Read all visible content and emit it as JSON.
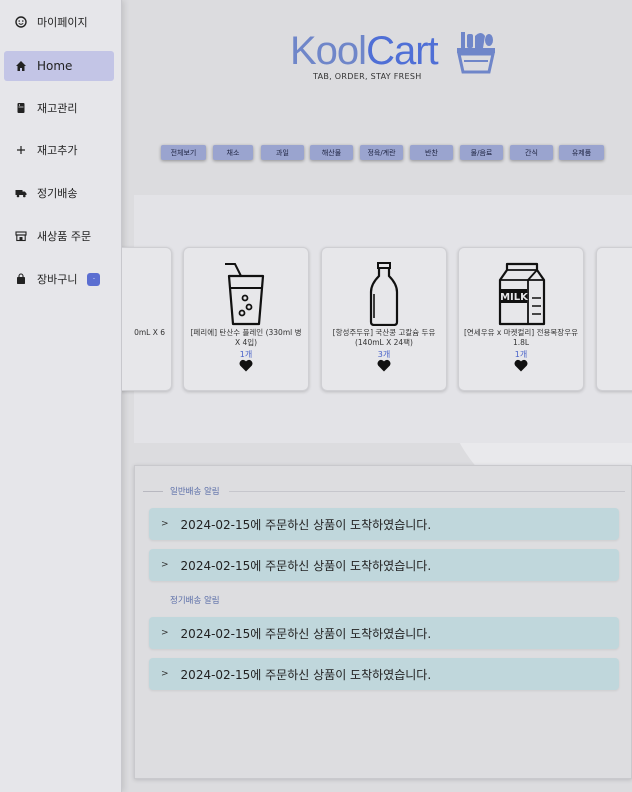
{
  "sidebar": {
    "items": [
      {
        "label": "마이페이지",
        "icon": "smiley-icon",
        "active": false
      },
      {
        "label": "Home",
        "icon": "home-icon",
        "active": true
      },
      {
        "label": "재고관리",
        "icon": "fridge-icon",
        "active": false
      },
      {
        "label": "재고추가",
        "icon": "plus-icon",
        "active": false
      },
      {
        "label": "정기배송",
        "icon": "truck-icon",
        "active": false
      },
      {
        "label": "새상품 주문",
        "icon": "store-icon",
        "active": false
      },
      {
        "label": "장바구니",
        "icon": "shopping-bag-icon",
        "active": false,
        "badge": "·"
      }
    ]
  },
  "logo": {
    "part1": "Kool",
    "part2": "Cart",
    "tagline": "TAB, ORDER, STAY FRESH",
    "icon": "grocery-basket-icon"
  },
  "categories": [
    "전체보기",
    "채소",
    "과일",
    "해산물",
    "정육/계란",
    "반찬",
    "물/음료",
    "간식",
    "유제품"
  ],
  "products": [
    {
      "name": "0mL X 6",
      "qty": "",
      "icon": "partial-card"
    },
    {
      "name": "[페리에] 탄산수 플레인 (330ml 병 X 4입)",
      "qty": "1개",
      "icon": "sparkling-drink-icon"
    },
    {
      "name": "[항성주두유] 국산콩 고칼슘 두유 (140mL X 24팩)",
      "qty": "3개",
      "icon": "milk-bottle-icon"
    },
    {
      "name": "[연세우유 x 마켓컬리] 전용목장우유 1.8L",
      "qty": "1개",
      "icon": "milk-carton-icon"
    },
    {
      "name": "",
      "qty": "",
      "icon": "partial-card"
    }
  ],
  "notifications": {
    "general_title": "일반배송 알림",
    "general": [
      "2024-02-15에 주문하신 상품이 도착하였습니다.",
      "2024-02-15에 주문하신 상품이 도착하였습니다."
    ],
    "regular_title": "정기배송 알림",
    "regular": [
      "2024-02-15에 주문하신 상품이 도착하였습니다.",
      "2024-02-15에 주문하신 상품이 도착하였습니다."
    ]
  },
  "colors": {
    "accent": "#5b6ed1",
    "chip": "#9aa4cf",
    "notif_row": "#c0d7dc"
  }
}
